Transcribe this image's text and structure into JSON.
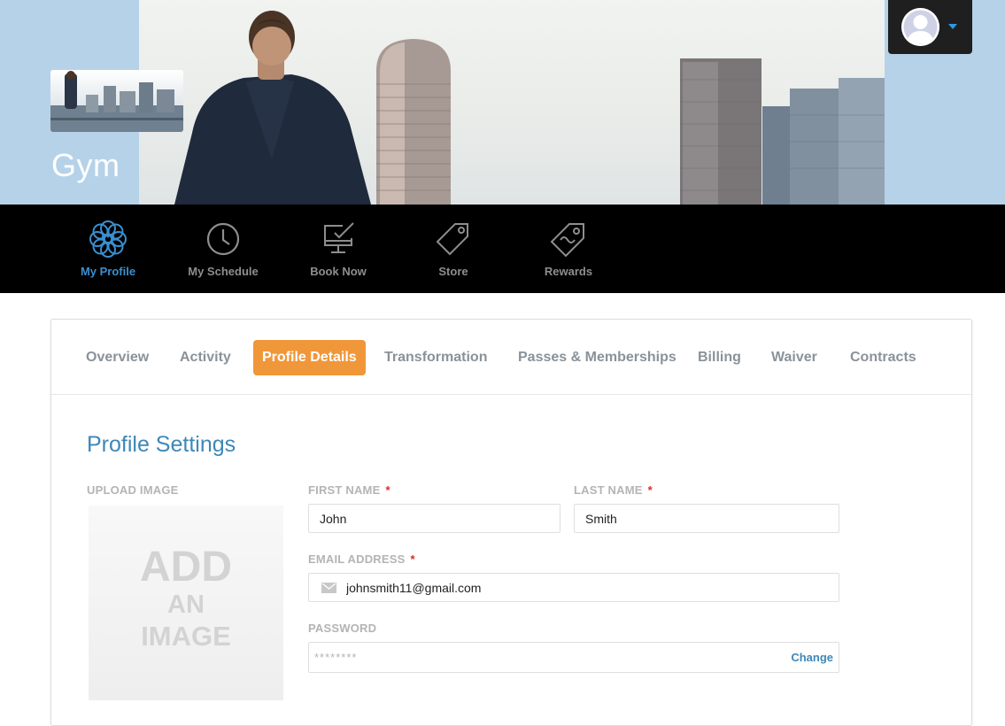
{
  "brand": {
    "title": "Gym"
  },
  "user_menu": {
    "avatar_icon": "user-avatar-icon",
    "caret_icon": "caret-down-icon",
    "accent": "#2b9be0"
  },
  "nav": {
    "items": [
      {
        "label": "My Profile",
        "icon": "flower-icon",
        "active": true
      },
      {
        "label": "My Schedule",
        "icon": "clock-icon",
        "active": false
      },
      {
        "label": "Book Now",
        "icon": "monitor-check-icon",
        "active": false
      },
      {
        "label": "Store",
        "icon": "price-tag-icon",
        "active": false
      },
      {
        "label": "Rewards",
        "icon": "coupon-tag-icon",
        "active": false
      }
    ],
    "active_color": "#3a8fd0"
  },
  "tabs": {
    "items": [
      {
        "label": "Overview"
      },
      {
        "label": "Activity"
      },
      {
        "label": "Profile Details",
        "active": true
      },
      {
        "label": "Transformation"
      },
      {
        "label": "Passes & Memberships"
      },
      {
        "label": "Billing"
      },
      {
        "label": "Waiver"
      },
      {
        "label": "Contracts"
      }
    ],
    "active_color": "#f0973a"
  },
  "profile": {
    "title": "Profile Settings",
    "upload": {
      "label": "UPLOAD IMAGE",
      "line1": "ADD",
      "line2": "AN",
      "line3": "IMAGE"
    },
    "first_name": {
      "label": "FIRST NAME",
      "required_mark": "*",
      "value": "John"
    },
    "last_name": {
      "label": "LAST NAME",
      "required_mark": "*",
      "value": "Smith"
    },
    "email": {
      "label": "EMAIL ADDRESS",
      "required_mark": "*",
      "value": "johnsmith11@gmail.com",
      "icon": "envelope-icon"
    },
    "password": {
      "label": "PASSWORD",
      "value": "********",
      "change_label": "Change"
    }
  }
}
